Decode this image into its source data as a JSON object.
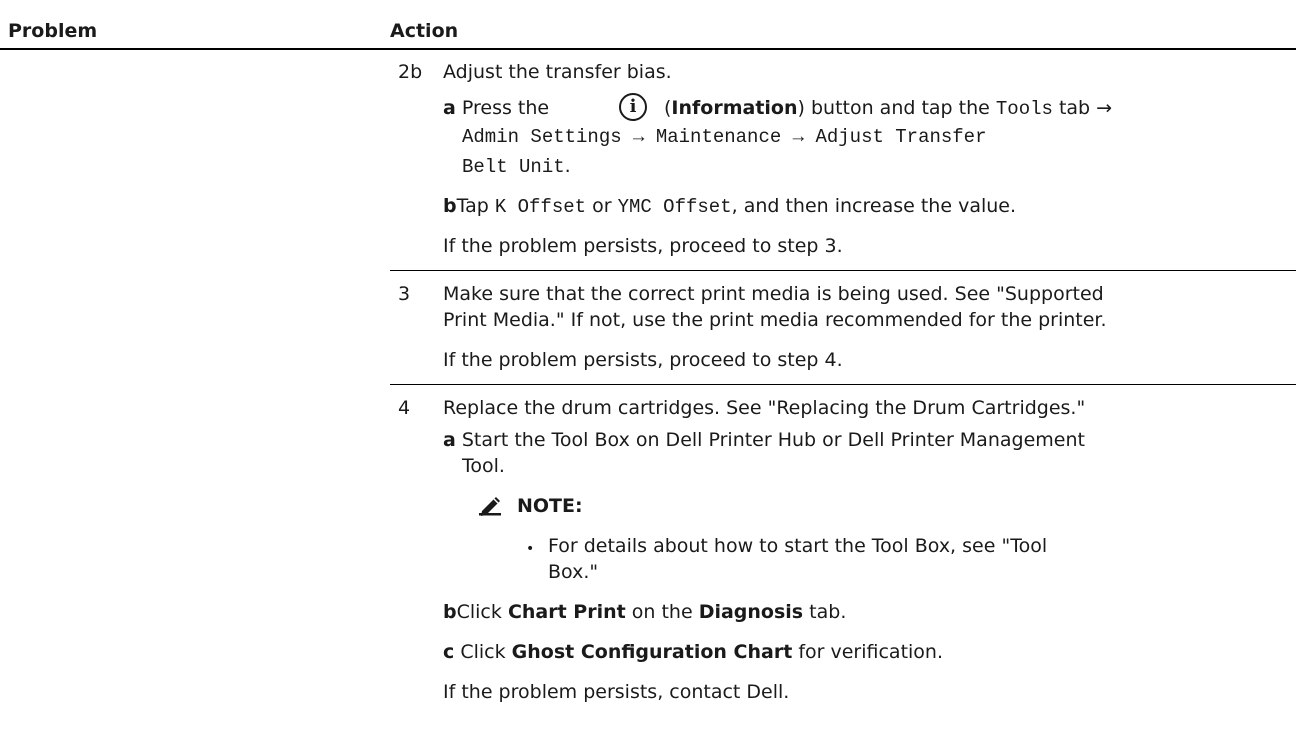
{
  "table": {
    "header": {
      "problem": "Problem",
      "action": "Action"
    },
    "step2b": {
      "num": "2b",
      "title": "Adjust the transfer bias.",
      "a": {
        "marker": "a",
        "t1": "Press the",
        "t2": "(",
        "info_bold": "Information",
        "t3": ") button and tap the",
        "tools": "Tools",
        "t4": "tab →",
        "line2": "Admin Settings → Maintenance → Adjust Transfer",
        "line3": "Belt Unit",
        "line3_end": "."
      },
      "b": {
        "marker": "b",
        "t1": "Tap",
        "k_offset": "K Offset",
        "or": "or",
        "ymc_offset": "YMC Offset",
        "t2": ", and then increase the value."
      },
      "persist": "If the problem persists, proceed to step 3."
    },
    "step3": {
      "num": "3",
      "line1": "Make sure that the correct print media is being used. See \"Supported",
      "line2": "Print Media.\" If not, use the print media recommended for the printer.",
      "persist": "If the problem persists, proceed to step 4."
    },
    "step4": {
      "num": "4",
      "title": "Replace the drum cartridges. See \"Replacing the Drum Cartridges.\"",
      "a": {
        "marker": "a",
        "line1": "Start the Tool Box on Dell Printer Hub or Dell Printer Management",
        "line2": "Tool."
      },
      "note": {
        "label": "NOTE:",
        "bullet": "•",
        "line1": "For details about how to start the Tool Box, see \"Tool",
        "line2": "Box.\""
      },
      "b": {
        "marker": "b",
        "t1": "Click",
        "bold1": "Chart Print",
        "t2": "on the",
        "bold2": "Diagnosis",
        "t3": "tab."
      },
      "c": {
        "marker": "c",
        "t1": "Click",
        "bold1": "Ghost Configuration Chart",
        "t2": "for verification."
      },
      "persist": "If the problem persists, contact Dell."
    }
  }
}
